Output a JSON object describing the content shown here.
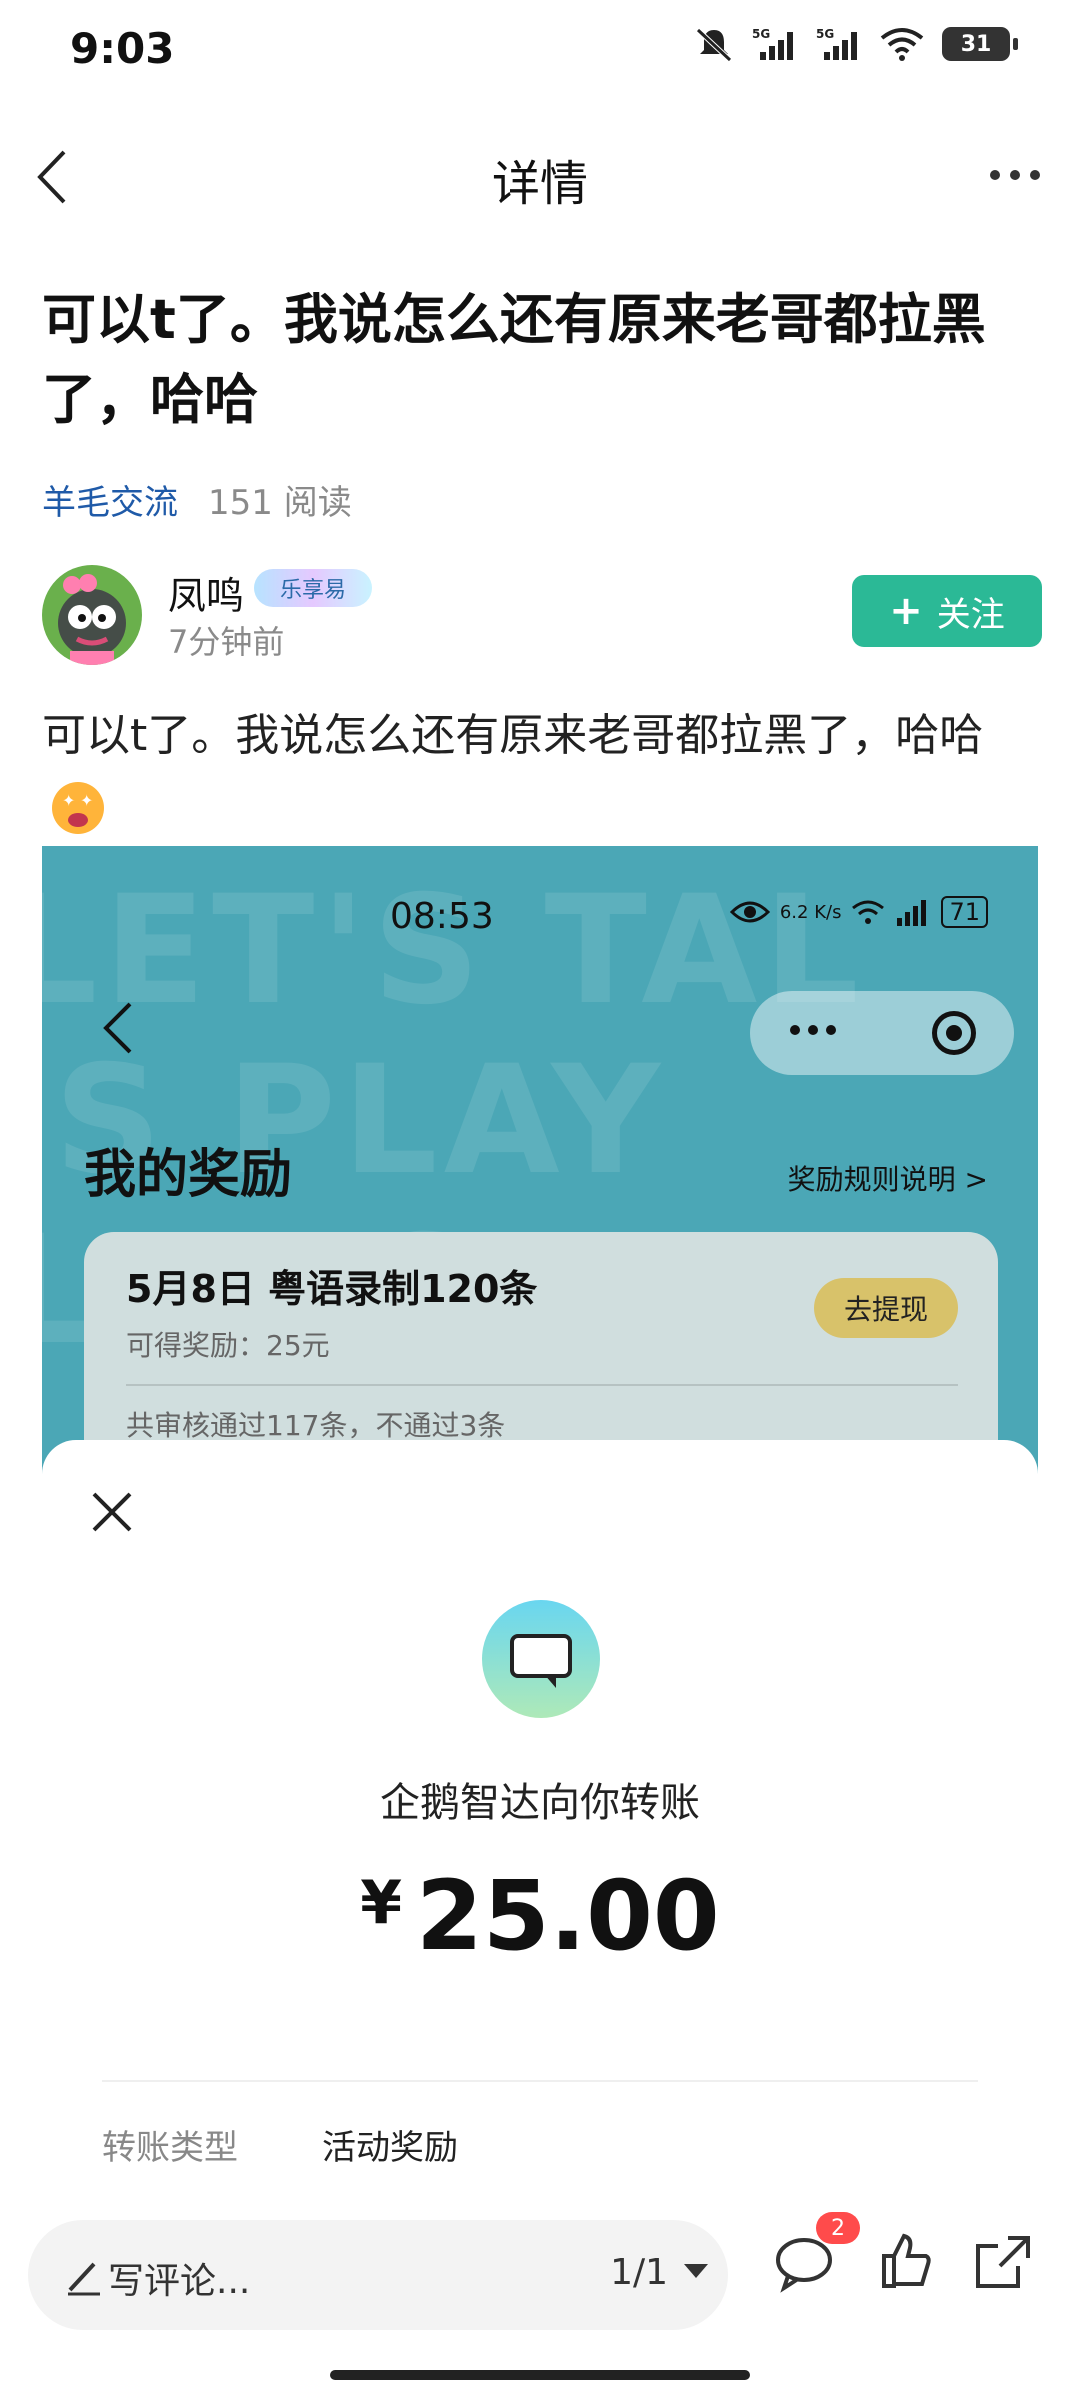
{
  "status_bar": {
    "time": "9:03",
    "battery": "31"
  },
  "header": {
    "title": "详情"
  },
  "post": {
    "title": "可以t了。我说怎么还有原来老哥都拉黑了，哈哈",
    "topic": "羊毛交流",
    "reads": "151 阅读",
    "body": "可以t了。我说怎么还有原来老哥都拉黑了，哈哈"
  },
  "author": {
    "name": "凤鸣",
    "badge": "乐享易",
    "time_ago": "7分钟前",
    "follow_label": "关注"
  },
  "screenshot": {
    "time": "08:53",
    "net_speed": "6.2 K/s",
    "battery": "71",
    "page_title": "我的奖励",
    "rules_link": "奖励规则说明 >",
    "card": {
      "title": "5月8日 粤语录制120条",
      "reward": "可得奖励：25元",
      "button": "去提现",
      "review": "共审核通过117条，不通过3条"
    },
    "transfer": {
      "sender": "企鹅智达向你转账",
      "currency": "¥",
      "amount": "25.00",
      "type_label": "转账类型",
      "type_value": "活动奖励"
    }
  },
  "bottom_bar": {
    "comment_placeholder": "写评论...",
    "pager": "1/1",
    "comment_count": "2"
  }
}
